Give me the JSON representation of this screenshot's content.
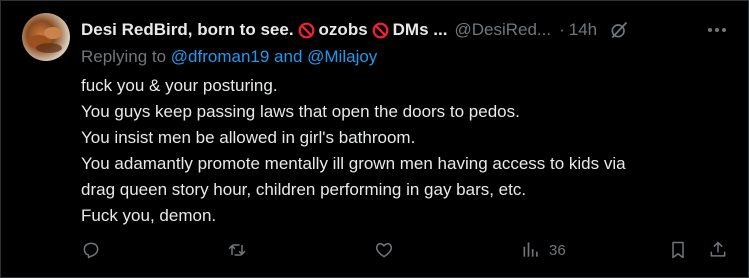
{
  "tweet": {
    "display_name": "Desi RedBird, born to see.",
    "name_word_1": "ozobs",
    "name_word_2": "DMs ...",
    "handle": "@DesiRed...",
    "dot": "·",
    "time": "14h",
    "replying_prefix": "Replying to",
    "replying_to": "@dfroman19 and @Milajoy",
    "lines": [
      "fuck you & your posturing.",
      "You guys keep passing laws that open the doors to pedos.",
      "You insist men be allowed in girl's bathroom.",
      "You adamantly promote mentally ill grown men having access to kids via",
      "drag queen story hour, children performing in gay bars, etc.",
      "Fuck you, demon."
    ],
    "views": "36"
  },
  "icons": {
    "ban": "no-entry-icon",
    "grok": "grok-icon",
    "more": "more-icon",
    "reply": "reply-icon",
    "retweet": "retweet-icon",
    "like": "like-icon",
    "views": "views-icon",
    "bookmark": "bookmark-icon",
    "share": "share-icon"
  },
  "colors": {
    "background": "#000000",
    "text": "#e7e9ea",
    "muted": "#71767b",
    "link": "#1d9bf0",
    "ban": "#f4212e"
  }
}
